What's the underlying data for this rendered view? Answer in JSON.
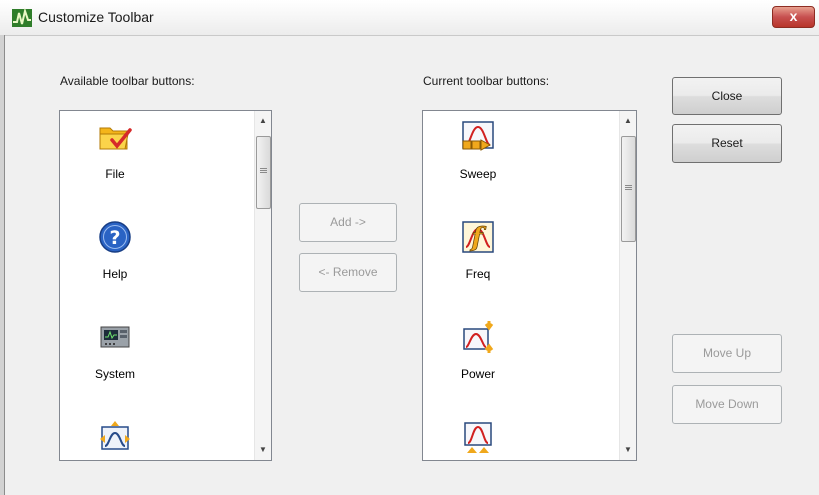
{
  "window": {
    "title": "Customize Toolbar",
    "close_glyph": "x"
  },
  "available": {
    "caption": "Available toolbar buttons:",
    "items": [
      {
        "label": "File",
        "icon": "folder-check-icon"
      },
      {
        "label": "Help",
        "icon": "help-icon"
      },
      {
        "label": "System",
        "icon": "system-instrument-icon"
      },
      {
        "label": "",
        "icon": "marker-arrows-icon"
      }
    ]
  },
  "current": {
    "caption": "Current toolbar buttons:",
    "items": [
      {
        "label": "Sweep",
        "icon": "sweep-icon"
      },
      {
        "label": "Freq",
        "icon": "freq-icon"
      },
      {
        "label": "Power",
        "icon": "power-icon"
      },
      {
        "label": "",
        "icon": "triggers-icon"
      }
    ]
  },
  "buttons": {
    "add": {
      "label": "Add ->",
      "enabled": false
    },
    "remove": {
      "label": "<- Remove",
      "enabled": false
    },
    "close": {
      "label": "Close",
      "enabled": true
    },
    "reset": {
      "label": "Reset",
      "enabled": true
    },
    "move_up": {
      "label": "Move Up",
      "enabled": false
    },
    "move_down": {
      "label": "Move Down",
      "enabled": false
    }
  },
  "colors": {
    "accent": "#c75050",
    "trace": "#cc1f1f",
    "arrow": "#f0a81c"
  }
}
